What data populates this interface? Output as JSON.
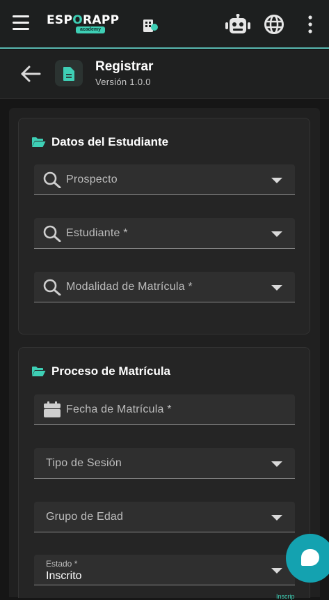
{
  "app": {
    "logo_text_a": "ESP",
    "logo_text_o": "O",
    "logo_text_b": "RAPP",
    "logo_sub": "academy"
  },
  "header": {
    "title": "Registrar",
    "version": "Versión 1.0.0"
  },
  "student_section": {
    "title": "Datos del Estudiante",
    "fields": [
      {
        "label": "Prospecto"
      },
      {
        "label": "Estudiante *"
      },
      {
        "label": "Modalidad de Matrícula *"
      }
    ]
  },
  "enrollment_section": {
    "title": "Proceso de Matrícula",
    "fecha_label": "Fecha de Matrícula *",
    "tipo_sesion_label": "Tipo de Sesión",
    "grupo_edad_label": "Grupo de Edad",
    "estado_label": "Estado *",
    "estado_value": "Inscrito"
  },
  "footer_peek": "Inscrip",
  "colors": {
    "accent": "#3ecfb5",
    "fab": "#14a2b0",
    "background": "#161616",
    "card": "#252525"
  },
  "icons": [
    "menu-icon",
    "school-icon",
    "robot-icon",
    "globe-icon",
    "kebab-icon",
    "back-arrow-icon",
    "document-icon",
    "folder-open-icon",
    "search-icon",
    "calendar-icon",
    "chevron-down-icon",
    "chat-icon"
  ]
}
